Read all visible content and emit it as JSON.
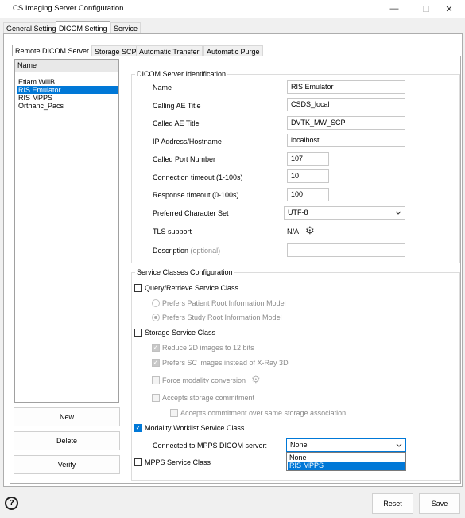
{
  "window": {
    "title": "CS Imaging Server Configuration",
    "minimize": "—",
    "maximize": "☐",
    "close": "✕"
  },
  "tabs": [
    "General Setting",
    "DICOM Setting",
    "Service"
  ],
  "subtabs": [
    "Remote DICOM Server",
    "Storage SCP",
    "Automatic Transfer",
    "Automatic Purge"
  ],
  "server_list": {
    "header": "Name",
    "items": [
      "Etiam WillB",
      "RIS Emulator",
      "RIS MPPS",
      "Orthanc_Pacs"
    ],
    "selected": "RIS Emulator"
  },
  "list_buttons": {
    "new": "New",
    "delete": "Delete",
    "verify": "Verify"
  },
  "identification": {
    "title": "DICOM Server Identification",
    "name_label": "Name",
    "name_value": "RIS Emulator",
    "calling_label": "Calling AE Title",
    "calling_value": "CSDS_local",
    "called_label": "Called AE Title",
    "called_value": "DVTK_MW_SCP",
    "ip_label": "IP Address/Hostname",
    "ip_value": "localhost",
    "port_label": "Called Port Number",
    "port_value": "107",
    "conn_label": "Connection timeout (1-100s)",
    "conn_value": "10",
    "resp_label": "Response timeout (0-100s)",
    "resp_value": "100",
    "charset_label": "Preferred Character Set",
    "charset_value": "UTF-8",
    "tls_label": "TLS support",
    "tls_value": "N/A",
    "desc_label": "Description",
    "desc_optional": "(optional)",
    "desc_value": ""
  },
  "service_classes": {
    "title": "Service Classes Configuration",
    "qr_label": "Query/Retrieve Service Class",
    "qr_patient": "Prefers Patient Root Information Model",
    "qr_study": "Prefers Study Root Information Model",
    "storage_label": "Storage Service Class",
    "reduce_2d": "Reduce 2D images to 12 bits",
    "prefers_sc": "Prefers SC images instead of X-Ray 3D",
    "force_modality": "Force modality conversion",
    "accepts_commit": "Accepts storage commitment",
    "accepts_commit_same": "Accepts commitment over same storage association",
    "mwl_label": "Modality Worklist Service Class",
    "mpps_connect_label": "Connected to MPPS DICOM server:",
    "mpps_connect_value": "None",
    "mpps_options": [
      "None",
      "RIS MPPS"
    ],
    "mpps_label": "MPPS Service Class"
  },
  "bottom": {
    "reset": "Reset",
    "save": "Save",
    "help_icon": "?"
  }
}
